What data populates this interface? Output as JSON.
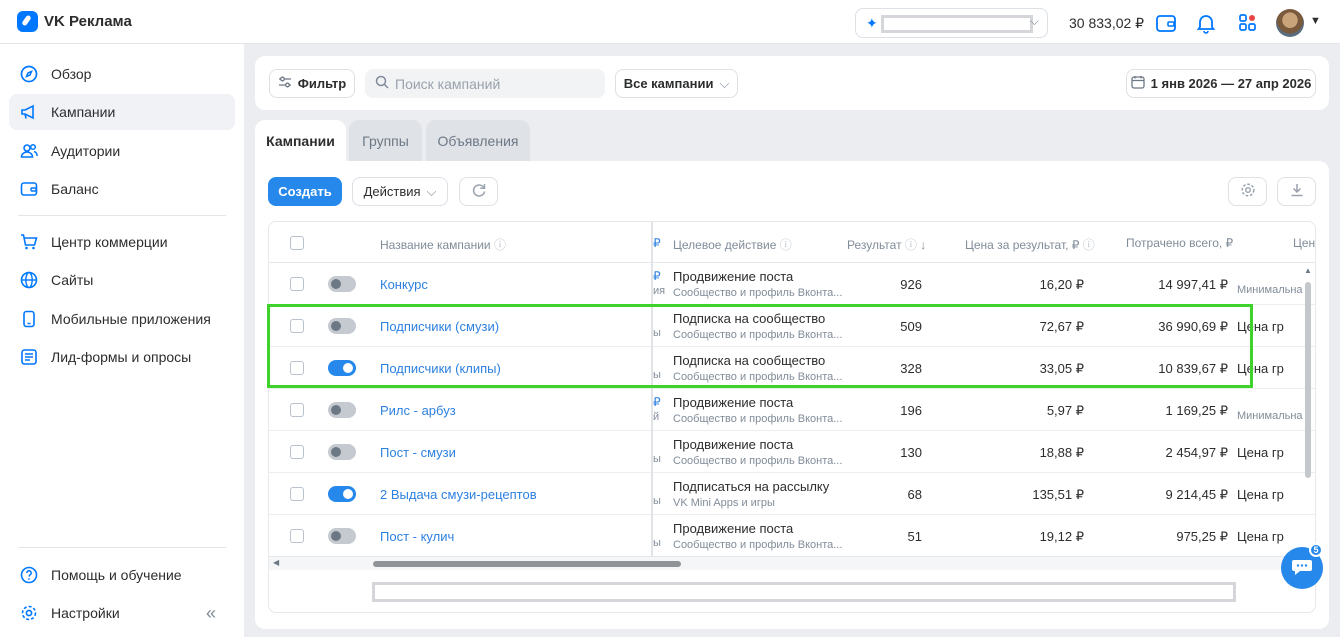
{
  "header": {
    "app_title": "VK Реклама",
    "balance": "30 833,02 ₽",
    "account_spark_icon": "sparkle-icon"
  },
  "sidebar": {
    "items": [
      {
        "label": "Обзор",
        "icon": "compass-icon"
      },
      {
        "label": "Кампании",
        "icon": "megaphone-icon"
      },
      {
        "label": "Аудитории",
        "icon": "users-icon"
      },
      {
        "label": "Баланс",
        "icon": "wallet-icon"
      },
      {
        "label": "Центр коммерции",
        "icon": "cart-icon"
      },
      {
        "label": "Сайты",
        "icon": "globe-icon"
      },
      {
        "label": "Мобильные приложения",
        "icon": "phone-icon"
      },
      {
        "label": "Лид-формы и опросы",
        "icon": "form-icon"
      }
    ],
    "help_label": "Помощь и обучение",
    "settings_label": "Настройки"
  },
  "filters": {
    "filter_label": "Фильтр",
    "search_placeholder": "Поиск кампаний",
    "campaign_select": "Все кампании",
    "date_range": "1 янв 2026 — 27 апр 2026"
  },
  "tabs": [
    {
      "label": "Кампании"
    },
    {
      "label": "Группы"
    },
    {
      "label": "Объявления"
    }
  ],
  "toolbar": {
    "create_label": "Создать",
    "actions_label": "Действия"
  },
  "table": {
    "headers": {
      "name": "Название кампании",
      "cut": "₽",
      "target": "Целевое действие",
      "result": "Результат",
      "cost_per_result": "Цена за результат, ₽",
      "spent": "Потрачено всего, ₽",
      "last": "Цен"
    },
    "rows": [
      {
        "enabled": false,
        "name": "Конкурс",
        "cut_top": "₽",
        "cut_bottom": "ия",
        "cut_blue": true,
        "target": "Продвижение поста",
        "target_sub": "Сообщество и профиль Вконта...",
        "result": "926",
        "cost": "16,20 ₽",
        "spent": "14 997,41 ₽",
        "last": "Минимальна",
        "last_small": true
      },
      {
        "enabled": false,
        "name": "Подписчики (смузи)",
        "cut_top": "",
        "cut_bottom": "ы",
        "cut_blue": false,
        "target": "Подписка на сообщество",
        "target_sub": "Сообщество и профиль Вконта...",
        "result": "509",
        "cost": "72,67 ₽",
        "spent": "36 990,69 ₽",
        "last": "Цена гр",
        "last_small": false
      },
      {
        "enabled": true,
        "name": "Подписчики (клипы)",
        "cut_top": "",
        "cut_bottom": "ы",
        "cut_blue": false,
        "target": "Подписка на сообщество",
        "target_sub": "Сообщество и профиль Вконта...",
        "result": "328",
        "cost": "33,05 ₽",
        "spent": "10 839,67 ₽",
        "last": "Цена гр",
        "last_small": false
      },
      {
        "enabled": false,
        "name": "Рилс - арбуз",
        "cut_top": "₽",
        "cut_bottom": "й",
        "cut_blue": true,
        "target": "Продвижение поста",
        "target_sub": "Сообщество и профиль Вконта...",
        "result": "196",
        "cost": "5,97 ₽",
        "spent": "1 169,25 ₽",
        "last": "Минимальна",
        "last_small": true
      },
      {
        "enabled": false,
        "name": "Пост - смузи",
        "cut_top": "",
        "cut_bottom": "ы",
        "cut_blue": false,
        "target": "Продвижение поста",
        "target_sub": "Сообщество и профиль Вконта...",
        "result": "130",
        "cost": "18,88 ₽",
        "spent": "2 454,97 ₽",
        "last": "Цена гр",
        "last_small": false
      },
      {
        "enabled": true,
        "name": "2 Выдача смузи-рецептов",
        "cut_top": "",
        "cut_bottom": "ы",
        "cut_blue": false,
        "target": "Подписаться на рассылку",
        "target_sub": "VK Mini Apps и игры",
        "result": "68",
        "cost": "135,51 ₽",
        "spent": "9 214,45 ₽",
        "last": "Цена гр",
        "last_small": false
      },
      {
        "enabled": false,
        "name": "Пост - кулич",
        "cut_top": "",
        "cut_bottom": "ы",
        "cut_blue": false,
        "target": "Продвижение поста",
        "target_sub": "Сообщество и профиль Вконта...",
        "result": "51",
        "cost": "19,12 ₽",
        "spent": "975,25 ₽",
        "last": "Цена гр",
        "last_small": false
      }
    ]
  },
  "chat": {
    "badge": "5"
  },
  "colors": {
    "accent": "#2688eb",
    "highlight": "#3fd22a"
  }
}
